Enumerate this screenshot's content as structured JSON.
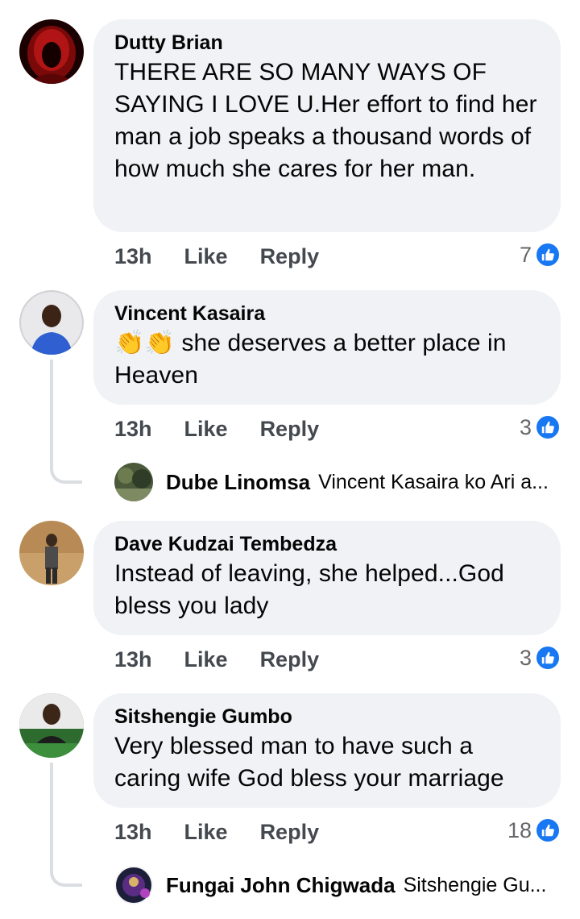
{
  "comments": [
    {
      "author": "Dutty Brian",
      "text": "THERE ARE SO MANY WAYS OF SAYING I LOVE U.Her effort to find her man a job speaks a thousand words of how much she cares for her man.",
      "time": "13h",
      "like_label": "Like",
      "reply_label": "Reply",
      "like_count": "7"
    },
    {
      "author": "Vincent Kasaira",
      "emoji": "👏👏",
      "text": " she deserves a better place in Heaven",
      "time": "13h",
      "like_label": "Like",
      "reply_label": "Reply",
      "like_count": "3",
      "reply_preview": {
        "author": "Dube Linomsa",
        "snippet": "Vincent Kasaira ko Ari a..."
      }
    },
    {
      "author": "Dave Kudzai Tembedza",
      "text": "Instead of leaving, she helped...God bless you lady",
      "time": "13h",
      "like_label": "Like",
      "reply_label": "Reply",
      "like_count": "3"
    },
    {
      "author": "Sitshengie Gumbo",
      "text": "Very blessed man to have such a caring wife God bless your marriage",
      "time": "13h",
      "like_label": "Like",
      "reply_label": "Reply",
      "like_count": "18",
      "reply_preview": {
        "author": "Fungai John Chigwada",
        "snippet": "Sitshengie Gu..."
      }
    }
  ],
  "icons": {
    "like_badge": "thumbs-up-icon"
  },
  "colors": {
    "like_blue": "#1877f2",
    "bubble_bg": "#f0f2f5"
  }
}
